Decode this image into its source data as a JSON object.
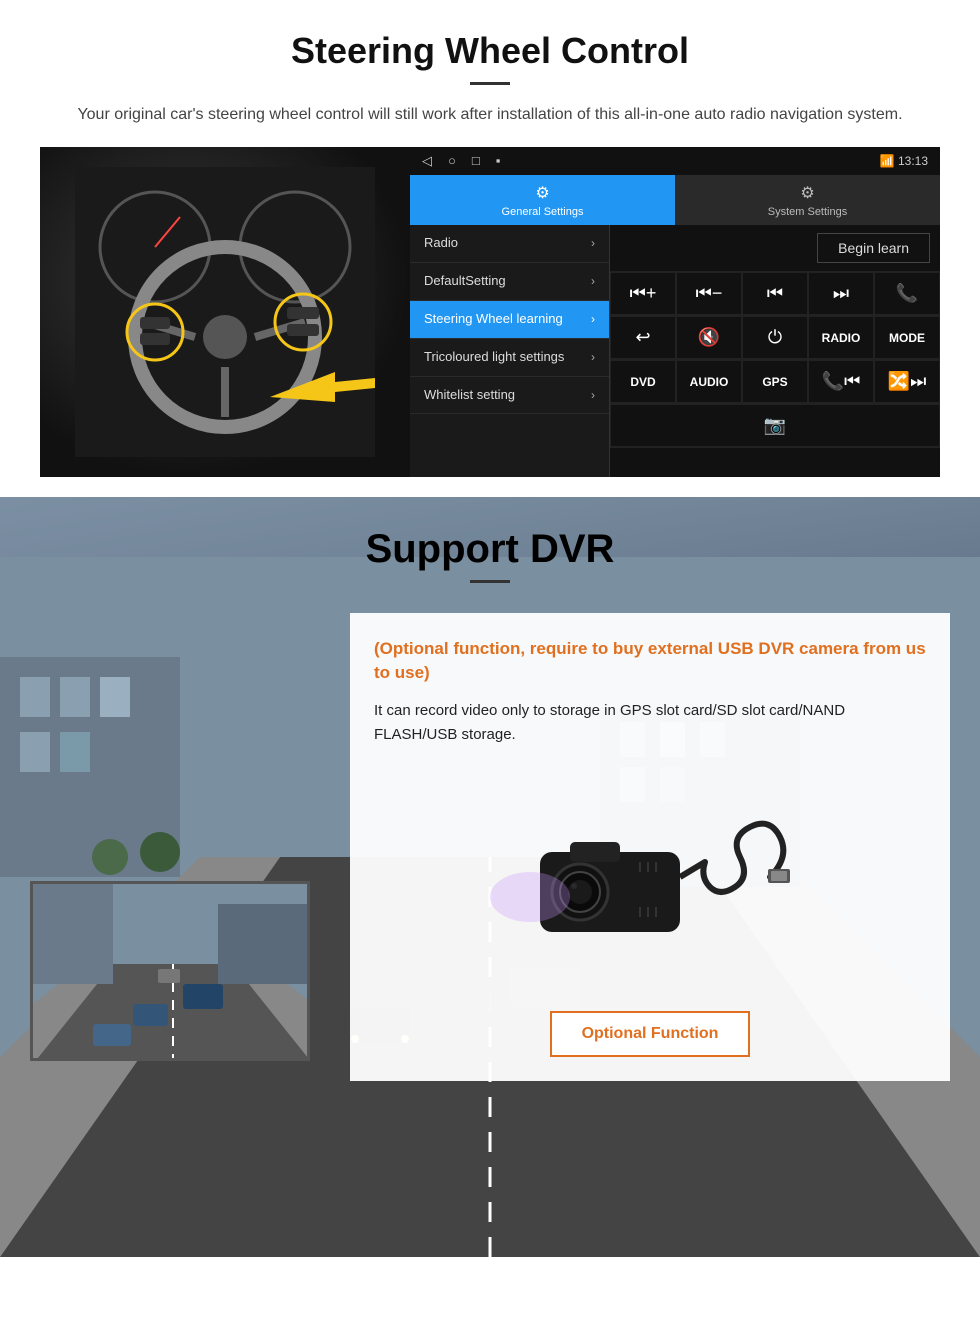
{
  "steering": {
    "title": "Steering Wheel Control",
    "subtitle": "Your original car's steering wheel control will still work after installation of this all-in-one auto radio navigation system.",
    "android": {
      "status_time": "13:13",
      "tabs": [
        {
          "label": "General Settings",
          "active": true,
          "icon": "⚙"
        },
        {
          "label": "System Settings",
          "active": false,
          "icon": "🔧"
        }
      ],
      "menu_items": [
        {
          "label": "Radio",
          "selected": false
        },
        {
          "label": "DefaultSetting",
          "selected": false
        },
        {
          "label": "Steering Wheel learning",
          "selected": true
        },
        {
          "label": "Tricoloured light settings",
          "selected": false
        },
        {
          "label": "Whitelist setting",
          "selected": false
        }
      ],
      "begin_learn_label": "Begin learn",
      "control_buttons": [
        [
          "⏮+",
          "⏮-",
          "⏮",
          "⏭",
          "📞"
        ],
        [
          "↩",
          "🔇",
          "⏻",
          "RADIO",
          "MODE"
        ],
        [
          "DVD",
          "AUDIO",
          "GPS",
          "📞⏮",
          "🔀⏭"
        ]
      ],
      "bottom_icon": "📷"
    }
  },
  "dvr": {
    "title": "Support DVR",
    "optional_text": "(Optional function, require to buy external USB DVR camera from us to use)",
    "desc_text": "It can record video only to storage in GPS slot card/SD slot card/NAND FLASH/USB storage.",
    "optional_function_label": "Optional Function"
  }
}
